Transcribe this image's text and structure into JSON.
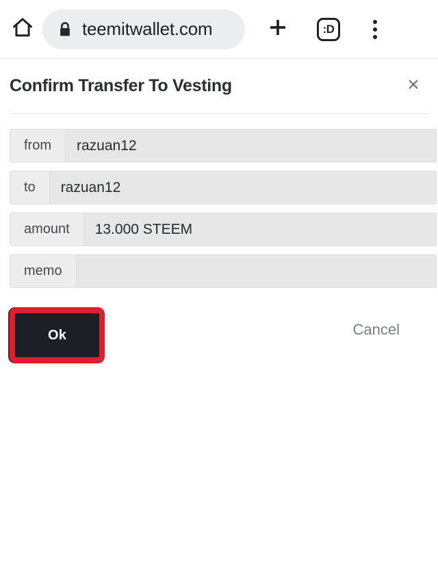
{
  "browser": {
    "home_icon": "home-icon",
    "lock_icon": "lock-icon",
    "url": "teemitwallet.com",
    "new_tab_icon": "plus-icon",
    "tab_switcher_label": ":D",
    "menu_icon": "more-vertical-icon",
    "colors": {
      "url_pill_bg": "#ecedef",
      "icon": "#1f2023",
      "text": "#202124"
    }
  },
  "dialog": {
    "title": "Confirm Transfer To Vesting",
    "close_icon": "close-icon",
    "close_glyph": "×",
    "fields": [
      {
        "label": "from",
        "value": "razuan12"
      },
      {
        "label": "to",
        "value": "razuan12"
      },
      {
        "label": "amount",
        "value": "13.000 STEEM"
      },
      {
        "label": "memo",
        "value": ""
      }
    ],
    "actions": {
      "ok_label": "Ok",
      "cancel_label": "Cancel",
      "highlight_color": "#e01e30",
      "ok_bg": "#1c2026",
      "cancel_color": "#7a7e83"
    }
  }
}
